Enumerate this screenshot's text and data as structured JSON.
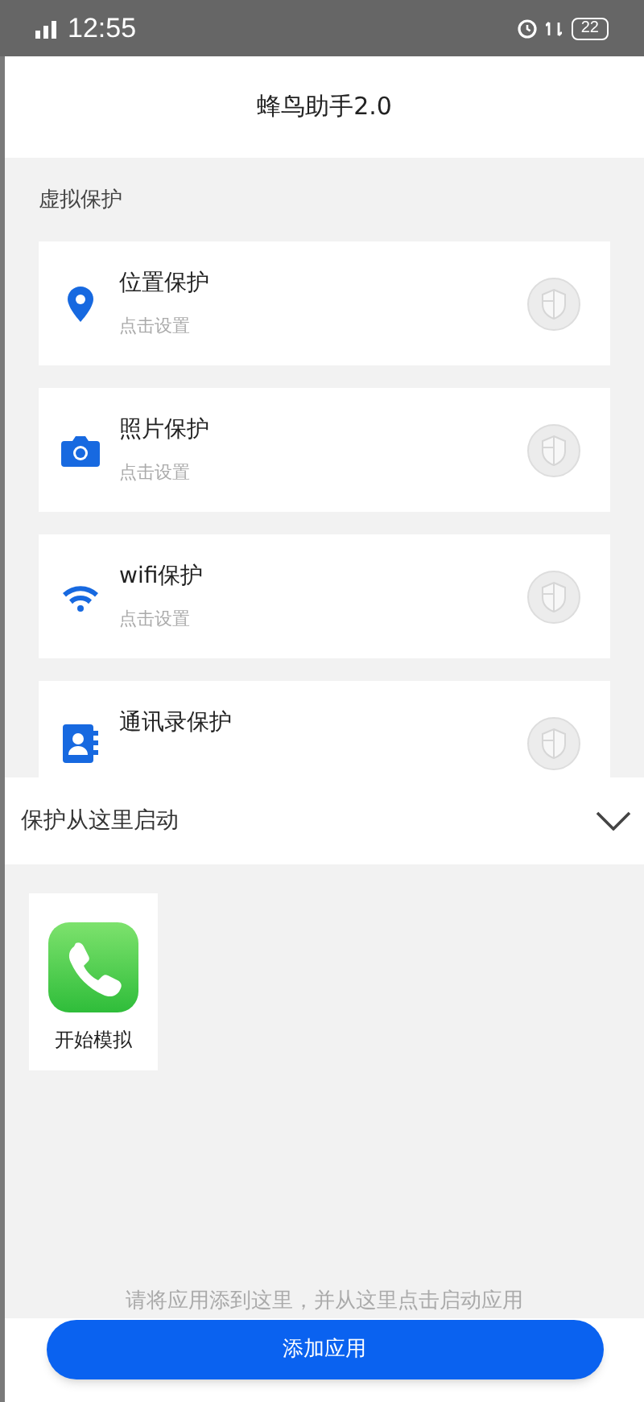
{
  "status_bar": {
    "time": "12:55",
    "battery": "22"
  },
  "header": {
    "title": "蜂鸟助手2.0"
  },
  "section_label": "虚拟保护",
  "protections": [
    {
      "kind": "location",
      "title": "位置保护",
      "subtitle": "点击设置",
      "on": false
    },
    {
      "kind": "camera",
      "title": "照片保护",
      "subtitle": "点击设置",
      "on": false
    },
    {
      "kind": "wifi",
      "title": "wifi保护",
      "subtitle": "点击设置",
      "on": false
    },
    {
      "kind": "contacts",
      "title": "通讯录保护",
      "on": false
    }
  ],
  "launcher": {
    "title": "保护从这里启动",
    "expanded": true,
    "apps": [
      {
        "label": "开始模拟"
      }
    ],
    "hint": "请将应用添到这里，并从这里点击启动应用",
    "button": "添加应用"
  }
}
